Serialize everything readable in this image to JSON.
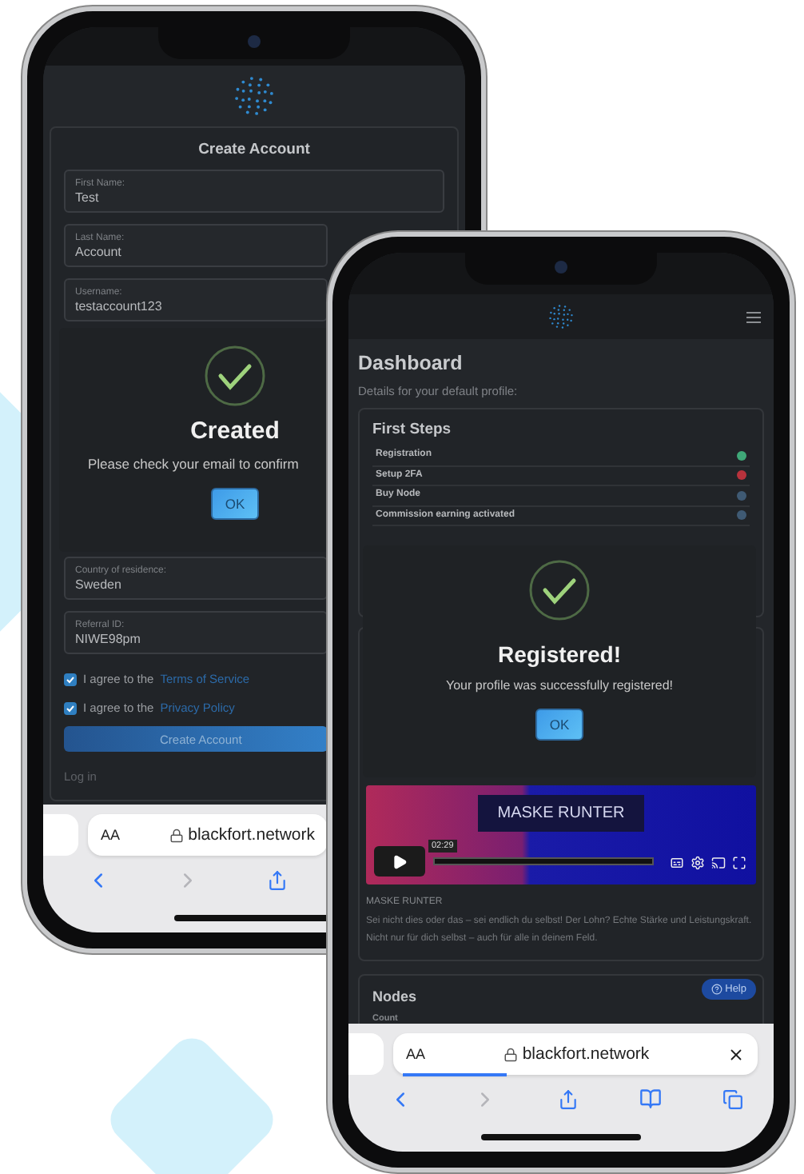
{
  "left_phone": {
    "signup": {
      "title": "Create Account",
      "top_fields": [
        {
          "label": "First Name:",
          "value": "Test"
        },
        {
          "label": "Last Name:",
          "value": "Account"
        },
        {
          "label": "Username:",
          "value": "testaccount123"
        }
      ],
      "bottom_fields": [
        {
          "label": "Country of residence:",
          "value": "Sweden"
        },
        {
          "label": "Referral ID:",
          "value": "NIWE98pm"
        }
      ],
      "agreements": [
        {
          "prefix": "I agree to the",
          "link": "Terms of Service",
          "checked": true
        },
        {
          "prefix": "I agree to the",
          "link": "Privacy Policy",
          "checked": true
        }
      ],
      "button": "Create Account",
      "login_link": "Log in"
    },
    "dialog": {
      "title": "Created",
      "message": "Please check your email to confirm",
      "button": "OK"
    },
    "browser": {
      "text_size": "AA",
      "url": "blackfort.network"
    }
  },
  "right_phone": {
    "dashboard": {
      "title": "Dashboard",
      "subtitle": "Details for your default profile:"
    },
    "first_steps": {
      "title": "First Steps",
      "steps": [
        {
          "label": "Registration",
          "color": "#3fa878"
        },
        {
          "label": "Setup 2FA",
          "color": "#b8323c"
        },
        {
          "label": "Buy Node",
          "color": "#3f5a74"
        },
        {
          "label": "Commission earning activated",
          "color": "#3f5a74"
        }
      ]
    },
    "dialog": {
      "title": "Registered!",
      "message": "Your profile was successfully registered!",
      "button": "OK"
    },
    "video": {
      "overlay_title": "MASKE RUNTER",
      "time": "02:29",
      "caption": "MASKE RUNTER",
      "description": "Sei nicht dies oder das – sei endlich du selbst! Der Lohn? Echte Stärke und Leistungskraft. Nicht nur für dich selbst – auch für alle in deinem Feld."
    },
    "nodes": {
      "title": "Nodes",
      "help": "Help",
      "column": "Count"
    },
    "browser": {
      "text_size": "AA",
      "url": "blackfort.network",
      "level": 0.3
    }
  }
}
